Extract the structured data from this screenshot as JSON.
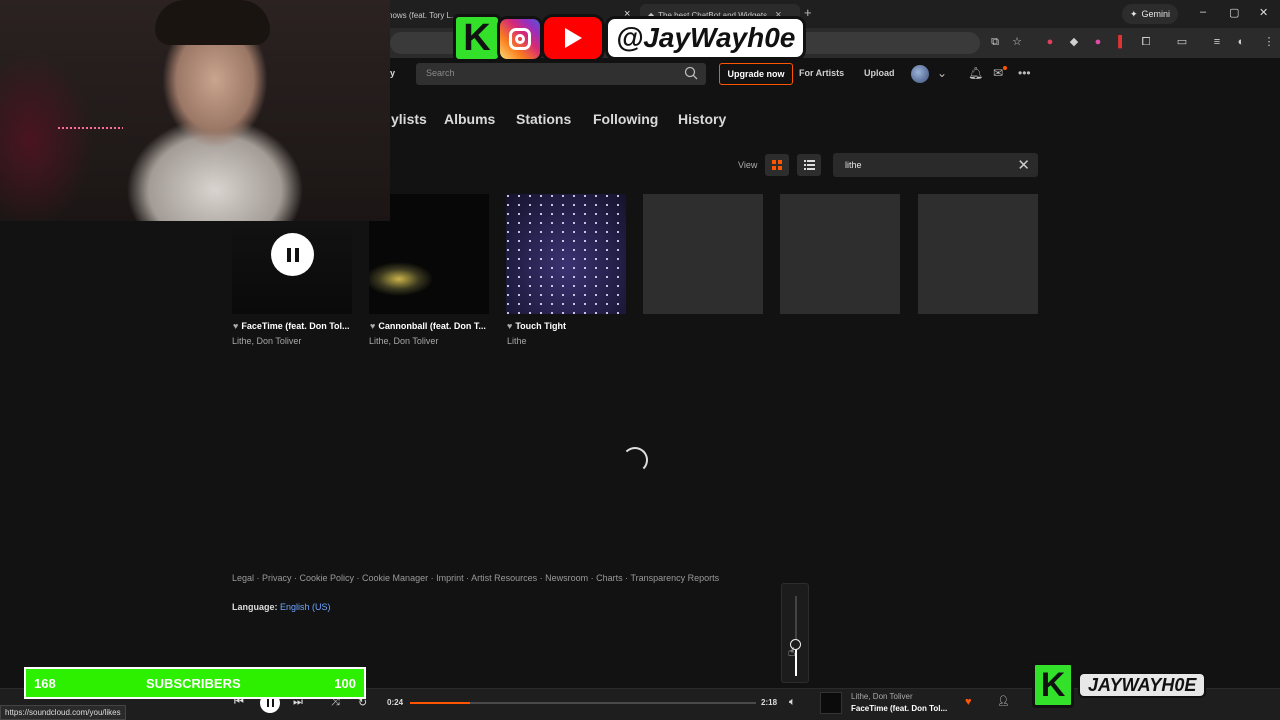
{
  "browser": {
    "tabs": [
      {
        "title": "nows (feat. Tory L...",
        "close": "×"
      },
      {
        "title": "",
        "close": "×"
      },
      {
        "title": "The best ChatBot and Widgets",
        "close": "×"
      }
    ],
    "new_tab": "+",
    "gemini_label": "Gemini",
    "window_controls": {
      "minimize": "–",
      "maximize": "▢",
      "close": "✕"
    }
  },
  "header": {
    "search_placeholder": "Search",
    "upgrade_label": "Upgrade now",
    "for_artists": "For Artists",
    "upload": "Upload",
    "logo_fragment": "y"
  },
  "library_tabs": [
    {
      "label": "ylists"
    },
    {
      "label": "Albums"
    },
    {
      "label": "Stations"
    },
    {
      "label": "Following"
    },
    {
      "label": "History"
    }
  ],
  "view": {
    "label": "View",
    "filter_value": "lithe",
    "filter_clear": "✕"
  },
  "tracks": [
    {
      "title": "FaceTime (feat. Don Tol...",
      "artist": "Lithe, Don Toliver",
      "playing": true
    },
    {
      "title": "Cannonball (feat. Don T...",
      "artist": "Lithe, Don Toliver",
      "playing": false
    },
    {
      "title": "Touch Tight",
      "artist": "Lithe",
      "playing": false
    }
  ],
  "footer": {
    "links": "Legal · Privacy · Cookie Policy · Cookie Manager · Imprint · Artist Resources · Newsroom · Charts · Transparency Reports",
    "language_label": "Language:",
    "language_value": "English (US)"
  },
  "player": {
    "elapsed": "0:24",
    "duration": "2:18",
    "progress_fraction": 0.174,
    "volume_fraction": 0.4,
    "now_playing_artist": "Lithe, Don Toliver",
    "now_playing_title": "FaceTime (feat. Don Tol..."
  },
  "status_url": "https://soundcloud.com/you/likes",
  "overlay": {
    "handle": "@JayWayh0e",
    "subscribers_current": "168",
    "subscribers_label": "SUBSCRIBERS",
    "subscribers_goal": "100",
    "logo_text": "JAYWAYH0E"
  },
  "colors": {
    "accent": "#ff5500",
    "subbar": "#2cf000",
    "link": "#6ea6ff"
  }
}
